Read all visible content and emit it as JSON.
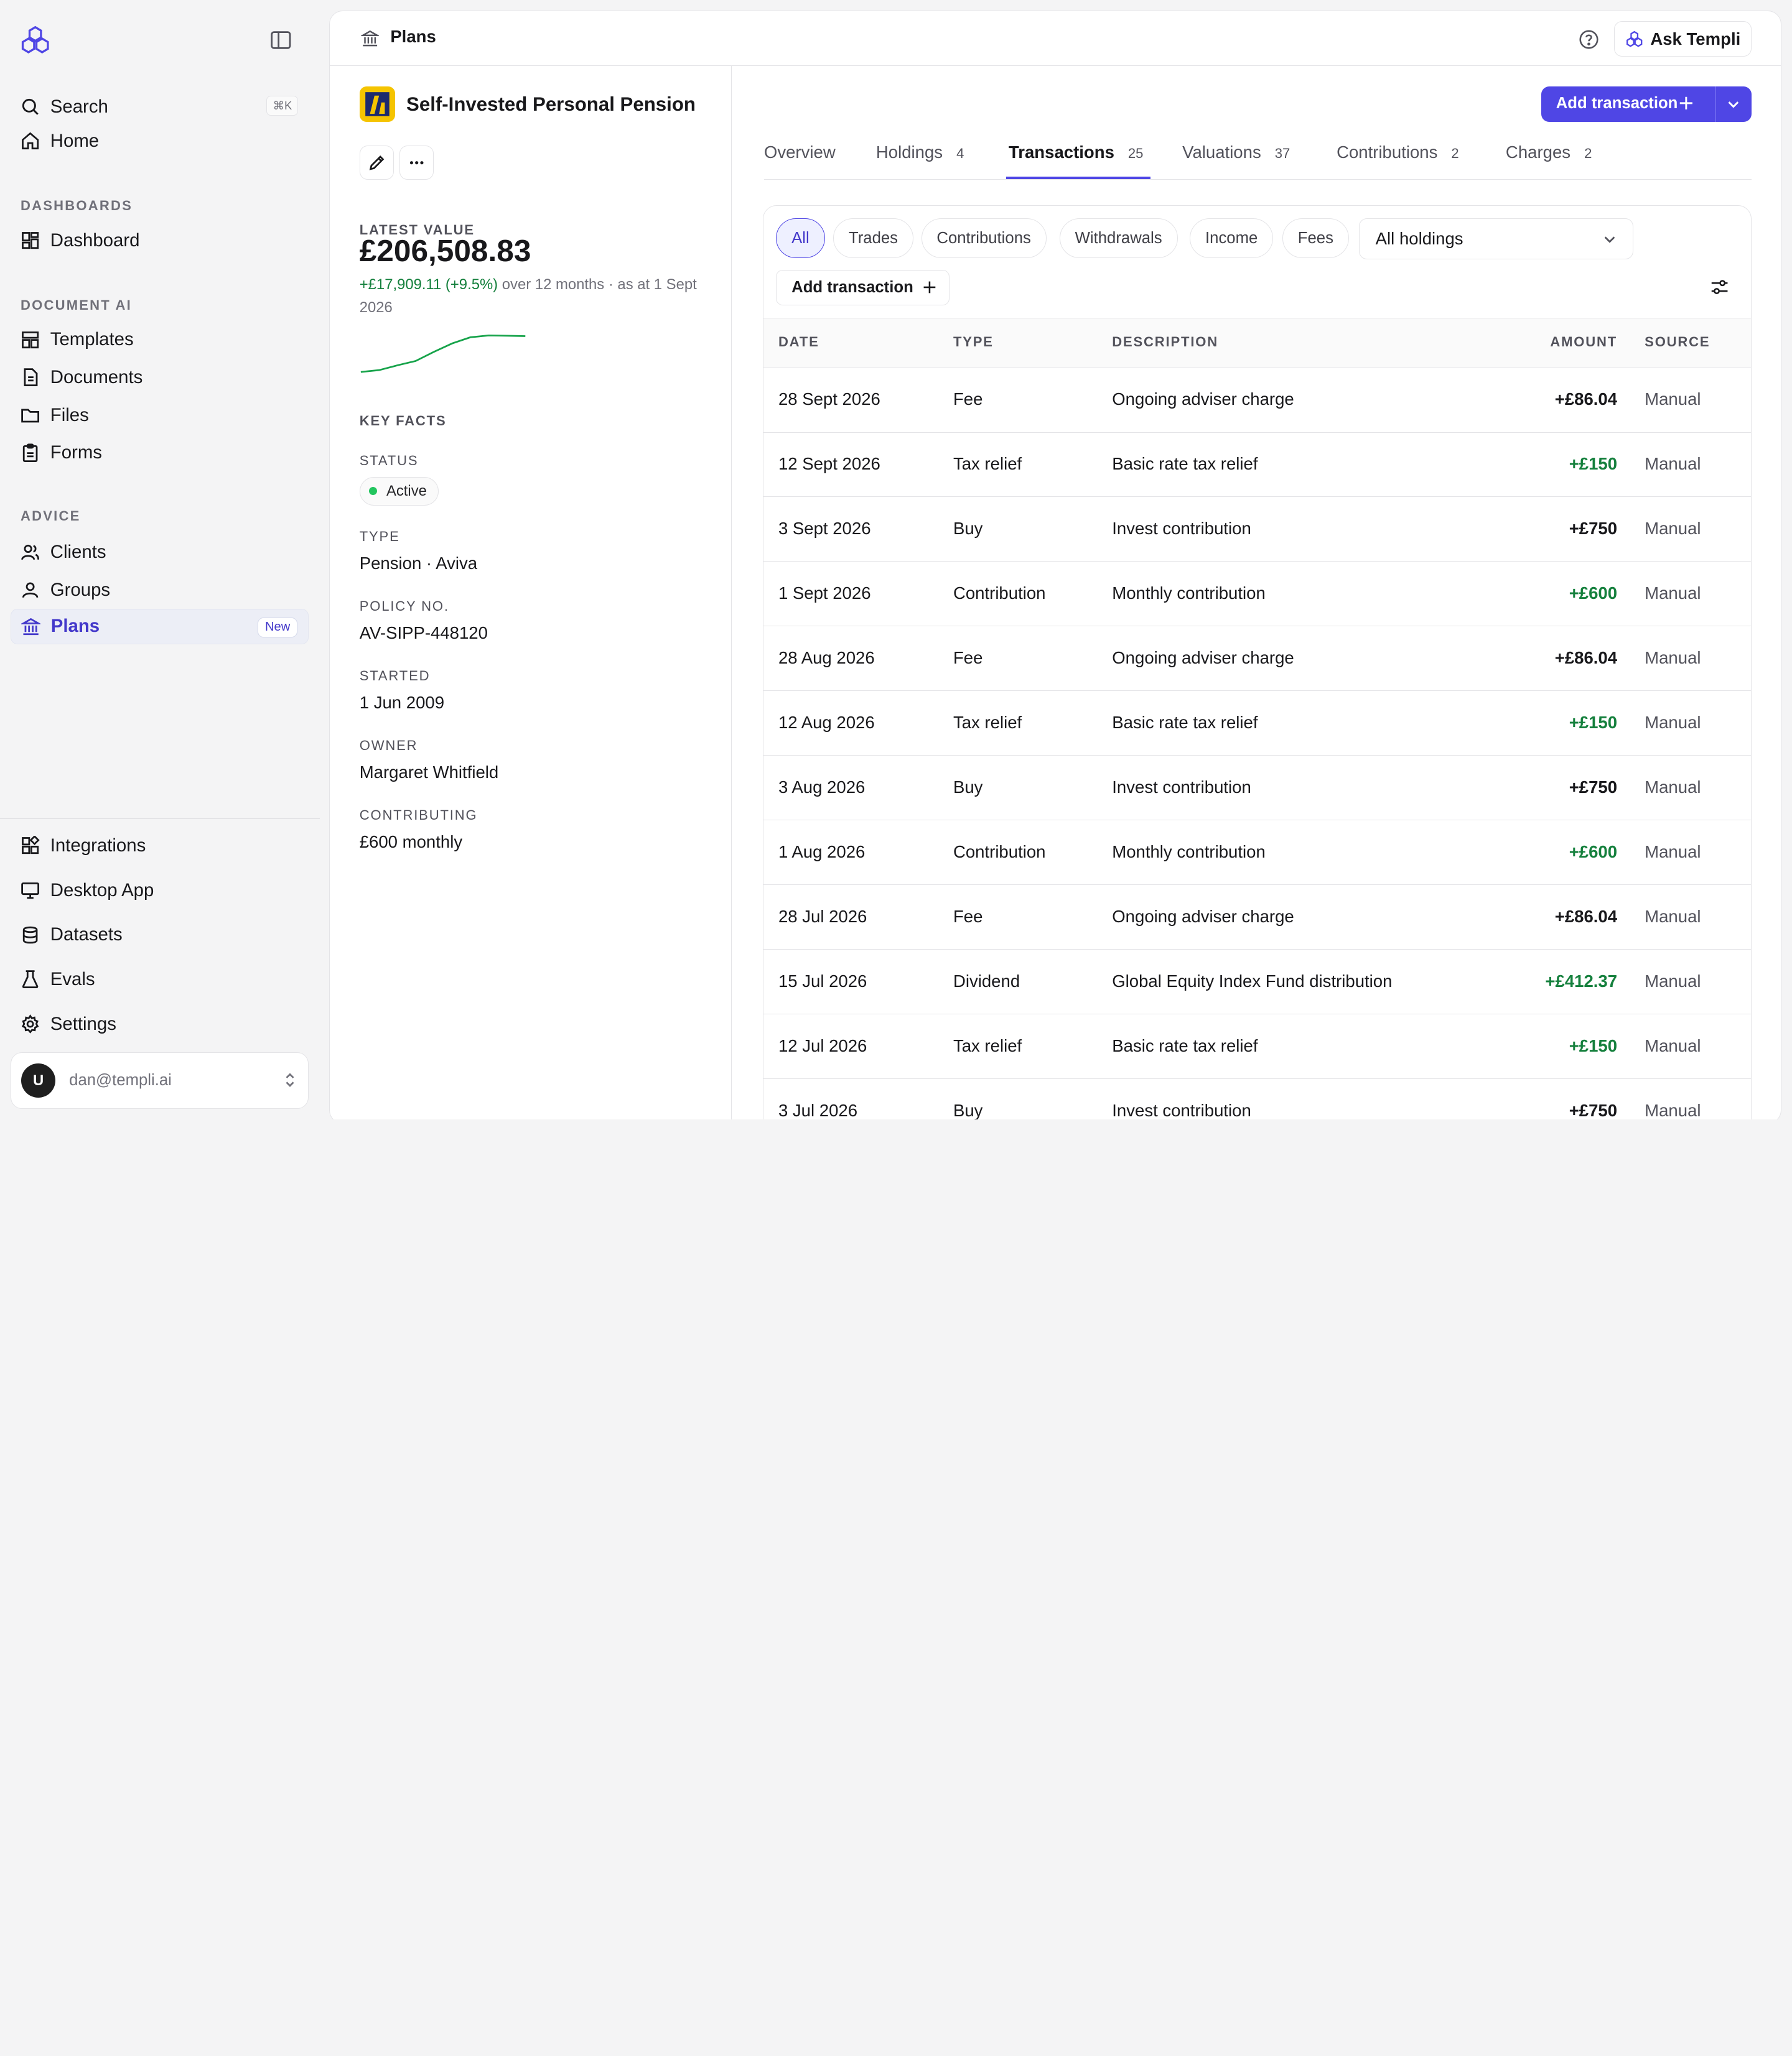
{
  "sidebar": {
    "search_label": "Search",
    "search_shortcut": "⌘K",
    "home_label": "Home",
    "sections": {
      "dashboards": "DASHBOARDS",
      "document_ai": "DOCUMENT AI",
      "advice": "ADVICE"
    },
    "dashboard_label": "Dashboard",
    "templates_label": "Templates",
    "documents_label": "Documents",
    "files_label": "Files",
    "forms_label": "Forms",
    "clients_label": "Clients",
    "groups_label": "Groups",
    "plans_label": "Plans",
    "plans_badge": "New",
    "integrations_label": "Integrations",
    "desktop_app_label": "Desktop App",
    "datasets_label": "Datasets",
    "evals_label": "Evals",
    "settings_label": "Settings",
    "user": {
      "initial": "U",
      "email": "dan@templi.ai"
    }
  },
  "topbar": {
    "breadcrumb": "Plans",
    "ask_label": "Ask Templi"
  },
  "plan": {
    "title": "Self-Invested Personal Pension",
    "latest_value_label": "LATEST VALUE",
    "latest_value": "£206,508.83",
    "change": "+£17,909.11 (+9.5%)",
    "change_suffix": " over 12 months · as at 1 Sept 2026",
    "sparkline": [
      0.0,
      0.05,
      0.18,
      0.3,
      0.55,
      0.78,
      0.95,
      1.0,
      0.99,
      0.98
    ],
    "key_facts_label": "KEY FACTS",
    "status_label": "STATUS",
    "status": "Active",
    "type_label": "TYPE",
    "type": "Pension · Aviva",
    "policy_label": "POLICY NO.",
    "policy": "AV-SIPP-448120",
    "started_label": "STARTED",
    "started": "1 Jun 2009",
    "owner_label": "OWNER",
    "owner": "Margaret Whitfield",
    "contributing_label": "CONTRIBUTING",
    "contributing": "£600 monthly"
  },
  "actions": {
    "add_transaction": "Add transaction"
  },
  "tabs": [
    {
      "label": "Overview",
      "count": ""
    },
    {
      "label": "Holdings",
      "count": "4"
    },
    {
      "label": "Transactions",
      "count": "25"
    },
    {
      "label": "Valuations",
      "count": "37"
    },
    {
      "label": "Contributions",
      "count": "2"
    },
    {
      "label": "Charges",
      "count": "2"
    }
  ],
  "filters": {
    "chips": [
      "All",
      "Trades",
      "Contributions",
      "Withdrawals",
      "Income",
      "Fees"
    ],
    "holdings_select": "All holdings",
    "add_transaction": "Add transaction"
  },
  "table": {
    "headers": {
      "date": "DATE",
      "type": "TYPE",
      "description": "DESCRIPTION",
      "amount": "AMOUNT",
      "source": "SOURCE"
    },
    "rows": [
      {
        "date": "28 Sept 2026",
        "type": "Fee",
        "description": "Ongoing adviser charge",
        "amount": "+£86.04",
        "positive": false,
        "source": "Manual"
      },
      {
        "date": "12 Sept 2026",
        "type": "Tax relief",
        "description": "Basic rate tax relief",
        "amount": "+£150",
        "positive": true,
        "source": "Manual"
      },
      {
        "date": "3 Sept 2026",
        "type": "Buy",
        "description": "Invest contribution",
        "amount": "+£750",
        "positive": false,
        "source": "Manual"
      },
      {
        "date": "1 Sept 2026",
        "type": "Contribution",
        "description": "Monthly contribution",
        "amount": "+£600",
        "positive": true,
        "source": "Manual"
      },
      {
        "date": "28 Aug 2026",
        "type": "Fee",
        "description": "Ongoing adviser charge",
        "amount": "+£86.04",
        "positive": false,
        "source": "Manual"
      },
      {
        "date": "12 Aug 2026",
        "type": "Tax relief",
        "description": "Basic rate tax relief",
        "amount": "+£150",
        "positive": true,
        "source": "Manual"
      },
      {
        "date": "3 Aug 2026",
        "type": "Buy",
        "description": "Invest contribution",
        "amount": "+£750",
        "positive": false,
        "source": "Manual"
      },
      {
        "date": "1 Aug 2026",
        "type": "Contribution",
        "description": "Monthly contribution",
        "amount": "+£600",
        "positive": true,
        "source": "Manual"
      },
      {
        "date": "28 Jul 2026",
        "type": "Fee",
        "description": "Ongoing adviser charge",
        "amount": "+£86.04",
        "positive": false,
        "source": "Manual"
      },
      {
        "date": "15 Jul 2026",
        "type": "Dividend",
        "description": "Global Equity Index Fund distribution",
        "amount": "+£412.37",
        "positive": true,
        "source": "Manual"
      },
      {
        "date": "12 Jul 2026",
        "type": "Tax relief",
        "description": "Basic rate tax relief",
        "amount": "+£150",
        "positive": true,
        "source": "Manual"
      },
      {
        "date": "3 Jul 2026",
        "type": "Buy",
        "description": "Invest contribution",
        "amount": "+£750",
        "positive": false,
        "source": "Manual"
      }
    ]
  },
  "colors": {
    "accent": "#4f46e5",
    "positive": "#15803d",
    "status_active": "#22c55e",
    "plan_logo": "#f5c400"
  },
  "icons": {
    "logo": "templi-logo-icon",
    "search": "search-icon",
    "home": "home-icon",
    "dashboard": "dashboard-icon",
    "templates": "templates-icon",
    "documents": "document-icon",
    "files": "folder-icon",
    "forms": "form-icon",
    "clients": "users-icon",
    "groups": "group-icon",
    "plans": "bank-icon",
    "integrations": "integrations-icon",
    "desktop": "monitor-icon",
    "datasets": "database-icon",
    "evals": "flask-icon",
    "settings": "gear-icon"
  }
}
